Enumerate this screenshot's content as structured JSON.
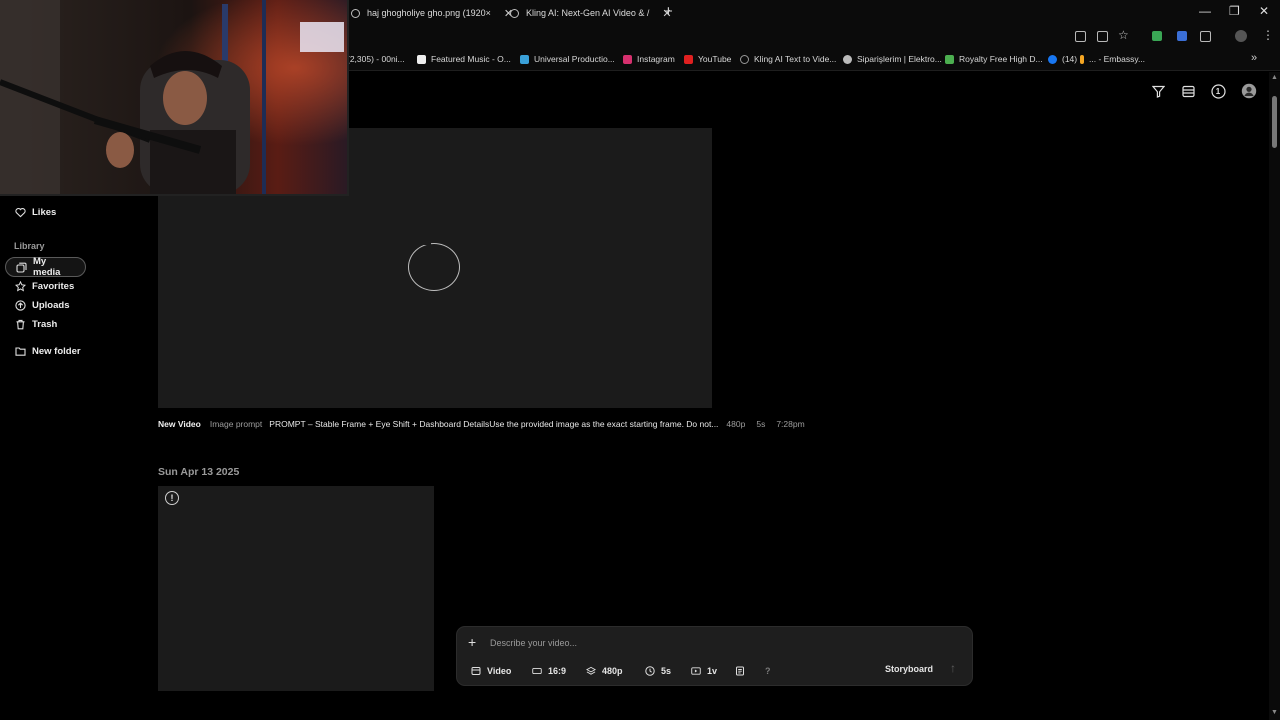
{
  "browser": {
    "tabs": [
      {
        "title": "haj ghogholiye gho.png (1920×"
      },
      {
        "title": "Kling AI: Next-Gen AI Video & /"
      }
    ],
    "new_tab": "+",
    "window_controls": {
      "minimize": "—",
      "restore": "❐",
      "close": "✕"
    },
    "bookmarks": [
      {
        "label": "(2,305) - 00ni...",
        "color": "#d33"
      },
      {
        "label": "Featured Music - O...",
        "color": "#eee"
      },
      {
        "label": "Universal Productio...",
        "color": "#3aa0d8"
      },
      {
        "label": "Instagram",
        "color": "#d6306e"
      },
      {
        "label": "YouTube",
        "color": "#e02020"
      },
      {
        "label": "Kling AI Text to Vide...",
        "color": "#999"
      },
      {
        "label": "Siparişlerim | Elektro...",
        "color": "#bbb"
      },
      {
        "label": "Royalty Free High D...",
        "color": "#4caf50"
      },
      {
        "label": "(14)",
        "color": "#1877f2"
      },
      {
        "label": "... - Embassy...",
        "color": "#f5a623"
      }
    ],
    "bookmarks_more": "»"
  },
  "header": {
    "icons": [
      "filter-icon",
      "list-view-icon",
      "notification-count-icon",
      "account-icon"
    ],
    "notification_count": "1"
  },
  "sidebar": {
    "top_items": [
      {
        "label": "Likes",
        "icon": "heart-icon"
      }
    ],
    "library_heading": "Library",
    "library_items": [
      {
        "label": "My media",
        "icon": "media-icon",
        "active": true
      },
      {
        "label": "Favorites",
        "icon": "star-icon"
      },
      {
        "label": "Uploads",
        "icon": "upload-icon"
      },
      {
        "label": "Trash",
        "icon": "trash-icon"
      }
    ],
    "new_folder": {
      "label": "New folder",
      "icon": "folder-icon"
    }
  },
  "main": {
    "video_item": {
      "title": "New Video",
      "prompt_type": "Image prompt",
      "prompt_text": "PROMPT – Stable Frame + Eye Shift + Dashboard DetailsUse the provided image as the exact starting frame. Do not...",
      "resolution": "480p",
      "duration": "5s",
      "time": "7:28pm"
    },
    "date_header": "Sun Apr 13 2025",
    "failed_card": {
      "icon": "warning-icon",
      "symbol": "!"
    }
  },
  "composer": {
    "plus": "+",
    "placeholder": "Describe your video...",
    "options": [
      {
        "label": "Video",
        "icon": "video-icon"
      },
      {
        "label": "16:9",
        "icon": "aspect-ratio-icon"
      },
      {
        "label": "480p",
        "icon": "resolution-icon"
      },
      {
        "label": "5s",
        "icon": "clock-icon"
      },
      {
        "label": "1v",
        "icon": "variations-icon"
      }
    ],
    "help": "?",
    "storyboard": "Storyboard",
    "send": "↑"
  }
}
